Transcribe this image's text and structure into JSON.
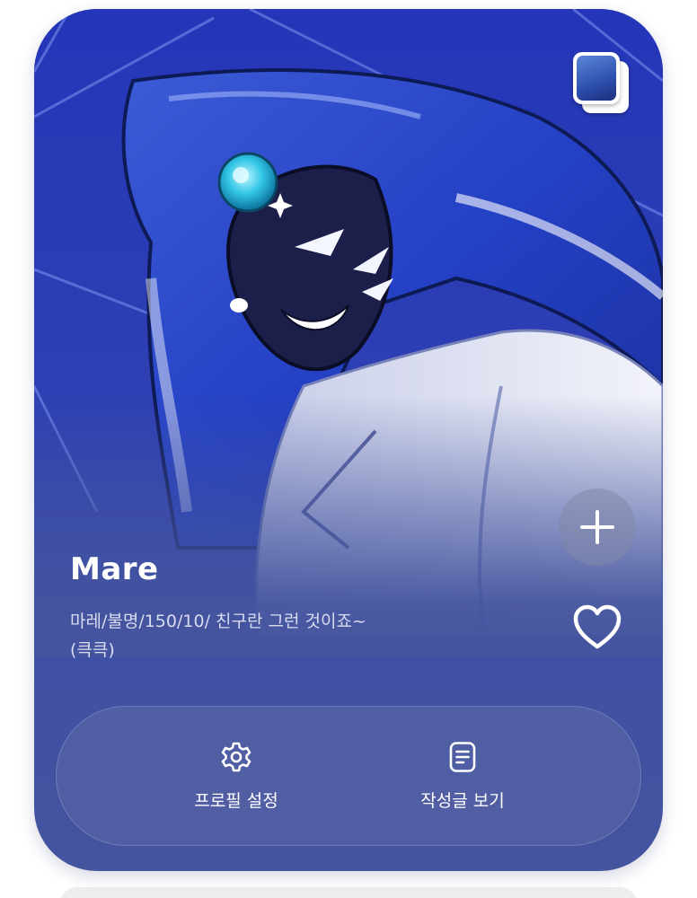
{
  "profile": {
    "name": "Mare",
    "description": "마레/불명/150/10/ 친구란 그런 것이죠~(큭큭)"
  },
  "actions": {
    "settings_label": "프로필 설정",
    "posts_label": "작성글 보기"
  },
  "icons": {
    "add": "plus-icon",
    "like": "heart-outline-icon",
    "settings": "gear-icon",
    "posts": "document-icon",
    "badge": "character-thumbnail"
  },
  "colors": {
    "card_top": "#2b3fb6",
    "card_bottom": "#44549e",
    "text_primary": "#ffffff",
    "text_secondary": "#d9dcf0"
  }
}
